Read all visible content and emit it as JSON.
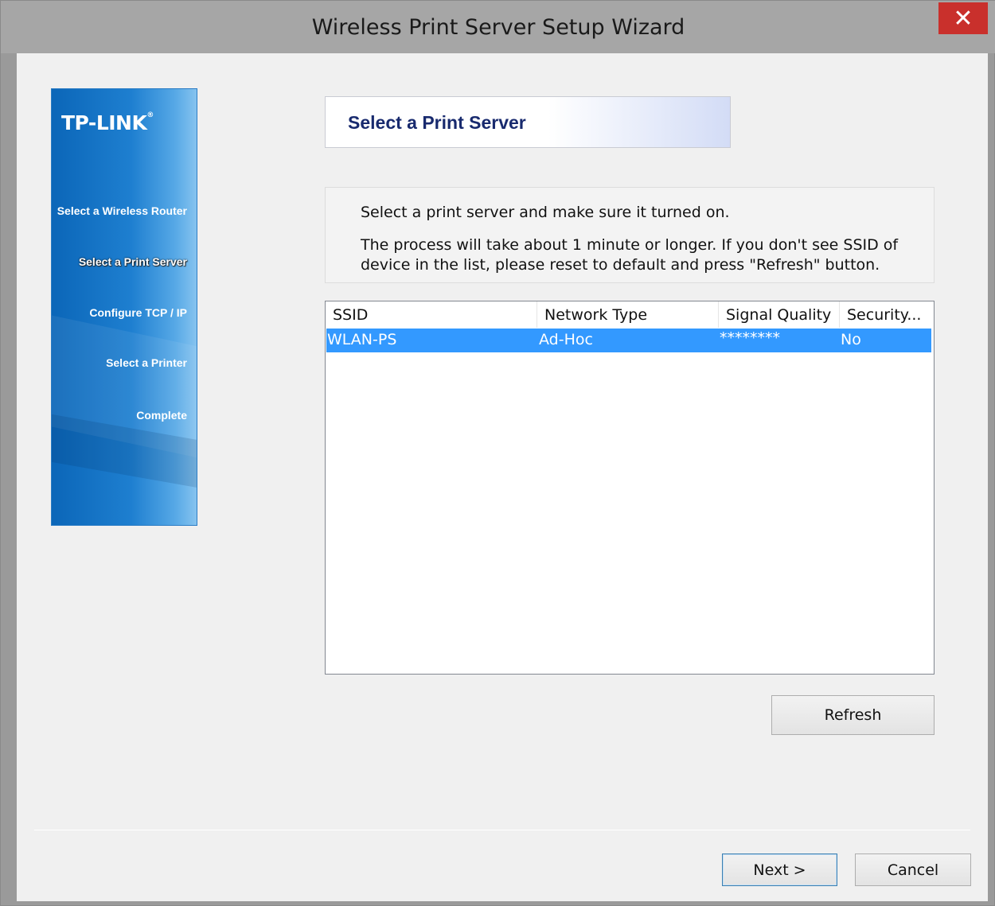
{
  "window": {
    "title": "Wireless Print Server Setup Wizard",
    "close_glyph": "✕"
  },
  "sidebar": {
    "brand": "TP-LINK",
    "brand_mark": "®",
    "steps": [
      {
        "label": "Select a Wireless Router",
        "active": false
      },
      {
        "label": "Select a Print Server",
        "active": true
      },
      {
        "label": "Configure TCP / IP",
        "active": false
      },
      {
        "label": "Select a Printer",
        "active": false
      },
      {
        "label": "Complete",
        "active": false
      }
    ]
  },
  "header": {
    "title": "Select a Print Server"
  },
  "info": {
    "line1": "Select a print server and make sure it turned on.",
    "line2": "The process will take about 1 minute or longer. If you don't see SSID of device in the list, please reset to default and press \"Refresh\" button."
  },
  "list": {
    "columns": [
      "SSID",
      "Network Type",
      "Signal Quality",
      "Security..."
    ],
    "rows": [
      {
        "ssid": "WLAN-PS",
        "network_type": "Ad-Hoc",
        "signal_quality": "********",
        "security": "No",
        "selected": true
      }
    ]
  },
  "buttons": {
    "refresh": "Refresh",
    "next": "Next >",
    "cancel": "Cancel"
  },
  "colors": {
    "selection": "#3399ff",
    "close_button": "#c9302c",
    "sidebar_blue": "#0b66b8",
    "header_text": "#182a6e"
  }
}
